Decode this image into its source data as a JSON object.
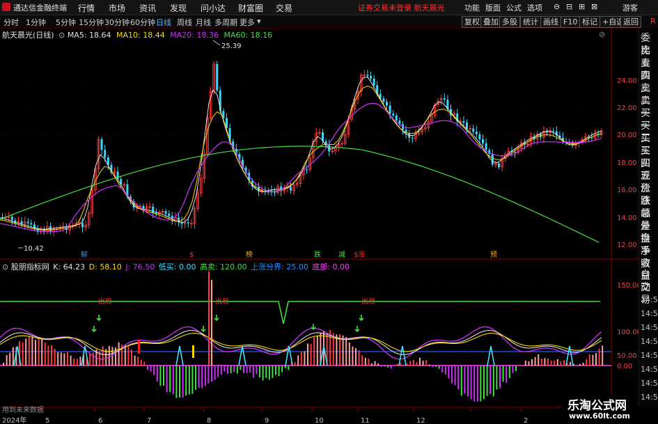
{
  "app": {
    "title": "通达信金融终端",
    "status_warning": "证券交易未登录 航天晨光"
  },
  "menu": [
    "行情",
    "市场",
    "资讯",
    "发现",
    "问小达",
    "财富圈",
    "交易"
  ],
  "right_menu": [
    "功能",
    "版面",
    "公式",
    "选项"
  ],
  "window_controls": [
    "⊖",
    "⊟",
    "⊞",
    "⊠"
  ],
  "user_label": "游客",
  "r_badge": "R",
  "toolbar": {
    "periods": [
      "分时",
      "1分钟",
      "5分钟",
      "15分钟",
      "30分钟",
      "60分钟",
      "日线",
      "周线",
      "月线",
      "多周期",
      "更多"
    ],
    "active_period": "日线",
    "right_buttons": [
      "复权",
      "叠加",
      "多股",
      "统计",
      "画线",
      "F10",
      "标记",
      "+自选",
      "返回"
    ]
  },
  "stock": {
    "name": "航天晨光(日线)"
  },
  "ma_legend": [
    {
      "label": "MA5: 18.64",
      "color": "#e0e0e0"
    },
    {
      "label": "MA10: 18.44",
      "color": "#ffd700"
    },
    {
      "label": "MA20: 18.36",
      "color": "#d030ff"
    },
    {
      "label": "MA60: 18.16",
      "color": "#40e040"
    }
  ],
  "price_axis": [
    "24.00",
    "22.00",
    "20.00",
    "18.00",
    "16.00",
    "14.00",
    "12.00"
  ],
  "price_high_label": "25.39",
  "price_low_label": "10.42",
  "event_markers": [
    {
      "label": "解",
      "color": "#1e90ff"
    },
    {
      "label": "$",
      "color": "#ff3030"
    },
    {
      "label": "榜",
      "color": "#ffa500"
    },
    {
      "label": "跌",
      "color": "#40e040"
    },
    {
      "label": "减",
      "color": "#40e040"
    },
    {
      "label": "$涨",
      "color": "#ff3030"
    },
    {
      "label": "预",
      "color": "#ffa500"
    }
  ],
  "indicator": {
    "name": "股朋指标网",
    "values": [
      {
        "label": "K: 64.23",
        "color": "#e0e0e0"
      },
      {
        "label": "D: 58.10",
        "color": "#ffd700"
      },
      {
        "label": "J: 76.50",
        "color": "#d030ff"
      },
      {
        "label": "低买: 0.00",
        "color": "#40e0ff"
      },
      {
        "label": "高卖: 120.00",
        "color": "#40e040"
      },
      {
        "label": "上涨分界: 25.00",
        "color": "#1e90ff"
      },
      {
        "label": "底部: 0.00",
        "color": "#ff40ff"
      }
    ],
    "axis": [
      "150.00",
      "100.00",
      "50.00",
      "0.00"
    ],
    "signal_text": "出局",
    "note": "用到未来数据"
  },
  "right_panel": [
    "委比",
    "卖五",
    "卖四",
    "卖三",
    "卖二",
    "卖一",
    "买一",
    "买二",
    "买三",
    "买四",
    "买五",
    "现价",
    "涨跌",
    "涨幅",
    "总量",
    "外盘",
    "换手",
    "净资",
    "收益",
    "自动",
    "交易"
  ],
  "time_ticks": [
    "14:56",
    "14:56",
    "14:56",
    "14:56",
    "14:56",
    "14:56",
    "14:56",
    "14:56"
  ],
  "x_axis": [
    "2024年",
    "5",
    "6",
    "7",
    "8",
    "9",
    "10",
    "11",
    "12",
    "",
    "",
    "2"
  ],
  "watermark": {
    "line1": "乐淘公式网",
    "line2": "www.60lt.com"
  }
}
